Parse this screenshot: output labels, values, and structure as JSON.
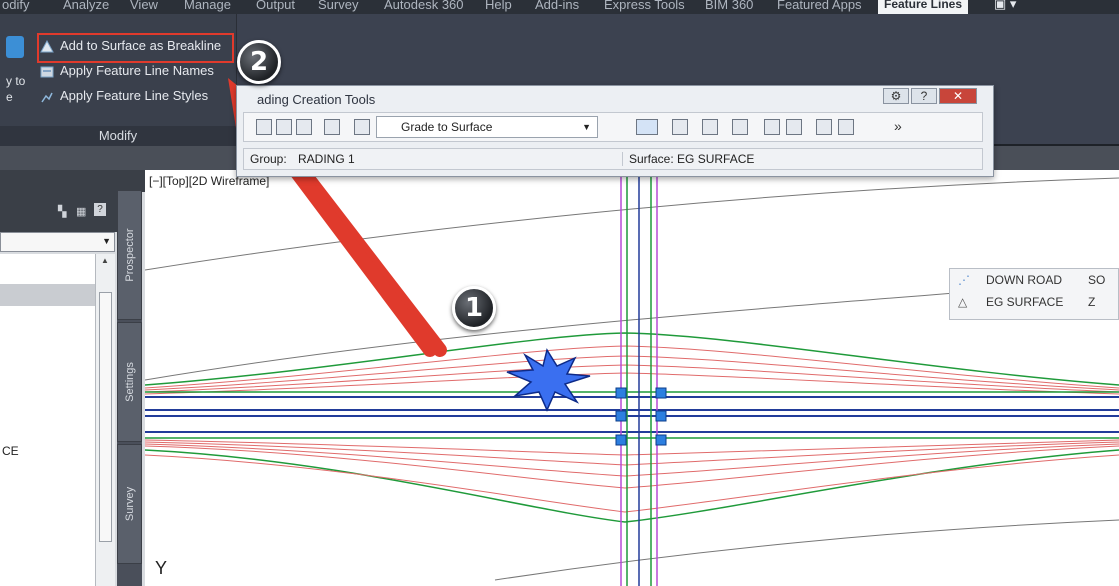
{
  "menubar": {
    "items": [
      "odify",
      "Analyze",
      "View",
      "Manage",
      "Output",
      "Survey",
      "Autodesk 360",
      "Help",
      "Add-ins",
      "Express Tools",
      "BIM 360",
      "Featured Apps"
    ],
    "active": "Feature Lines"
  },
  "ribbon": {
    "commands": [
      {
        "label": "Add to Surface as Breakline",
        "icon": "breakline-icon"
      },
      {
        "label": "Apply Feature Line Names",
        "icon": "feature-line-names-icon"
      },
      {
        "label": "Apply Feature Line Styles",
        "icon": "feature-line-styles-icon"
      }
    ],
    "panel_title": "Modify",
    "truncated_left": [
      "y to",
      "e"
    ]
  },
  "grading_window": {
    "title": "ading Creation Tools",
    "combo_value": "Grade to Surface",
    "group_label": "Group:",
    "group_value": "RADING 1",
    "surface_label": "Surface: EG SURFACE"
  },
  "viewport": {
    "label": "[−][Top][2D Wireframe]",
    "axis_label": "Y"
  },
  "palette": {
    "side_text": "CE",
    "tabs": [
      "Prospector",
      "Settings",
      "Survey"
    ]
  },
  "context_box": {
    "row1": [
      "DOWN ROAD",
      "SO"
    ],
    "row2": [
      "EG SURFACE",
      "Z"
    ]
  },
  "callouts": [
    {
      "number": "1"
    },
    {
      "number": "2"
    }
  ],
  "colors": {
    "arrow": "#e03a2c",
    "feature_line_green": "#1f9a3a",
    "grade_red": "#e06b6b",
    "road_blue": "#223c9a"
  }
}
